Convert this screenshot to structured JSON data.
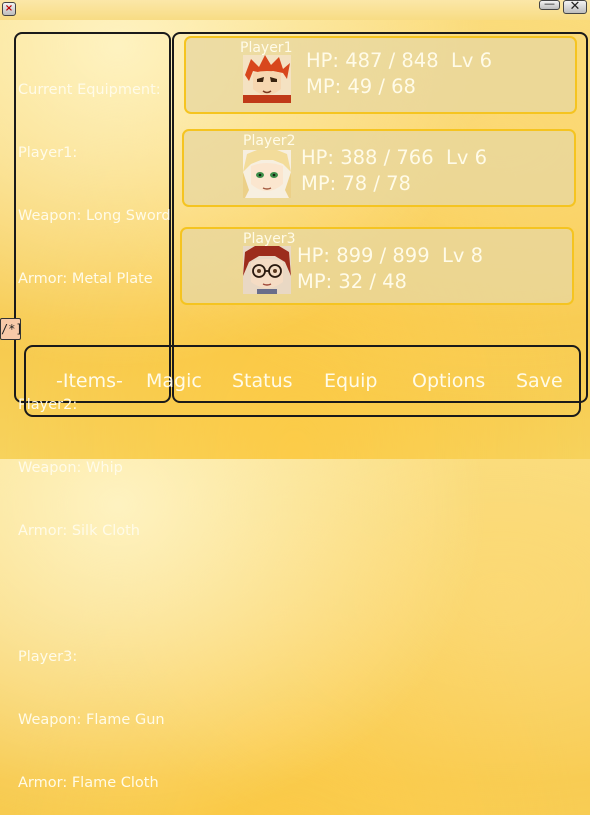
{
  "window": {
    "close_left_glyph": "×",
    "minimize_glyph": "—",
    "close_glyph": "✕"
  },
  "equipment": {
    "heading": "Current Equipment:",
    "players": [
      {
        "name": "Player1:",
        "weapon": "Weapon: Long Sword",
        "armor": "Armor: Metal Plate"
      },
      {
        "name": "Player2:",
        "weapon": "Weapon: Whip",
        "armor": "Armor: Silk Cloth"
      },
      {
        "name": "Player3:",
        "weapon": "Weapon: Flame Gun",
        "armor": "Armor: Flame Cloth"
      }
    ]
  },
  "party": [
    {
      "name": "Player1",
      "hp_line": "HP: 487 / 848  Lv 6",
      "mp_line": "MP: 49 / 68",
      "portrait_icon": "red-haired-hero-portrait-icon"
    },
    {
      "name": "Player2",
      "hp_line": "HP: 388 / 766  Lv 6",
      "mp_line": "MP: 78 / 78",
      "portrait_icon": "blonde-green-eyed-portrait-icon"
    },
    {
      "name": "Player3",
      "hp_line": "HP: 899 / 899  Lv 8",
      "mp_line": "MP: 32 / 48",
      "portrait_icon": "red-haired-glasses-portrait-icon"
    }
  ],
  "side_tag": "/*]",
  "menu": {
    "items": [
      "-Items-",
      "Magic",
      "Status",
      "Equip",
      "Options",
      "Save"
    ],
    "selected": "-Items-"
  }
}
